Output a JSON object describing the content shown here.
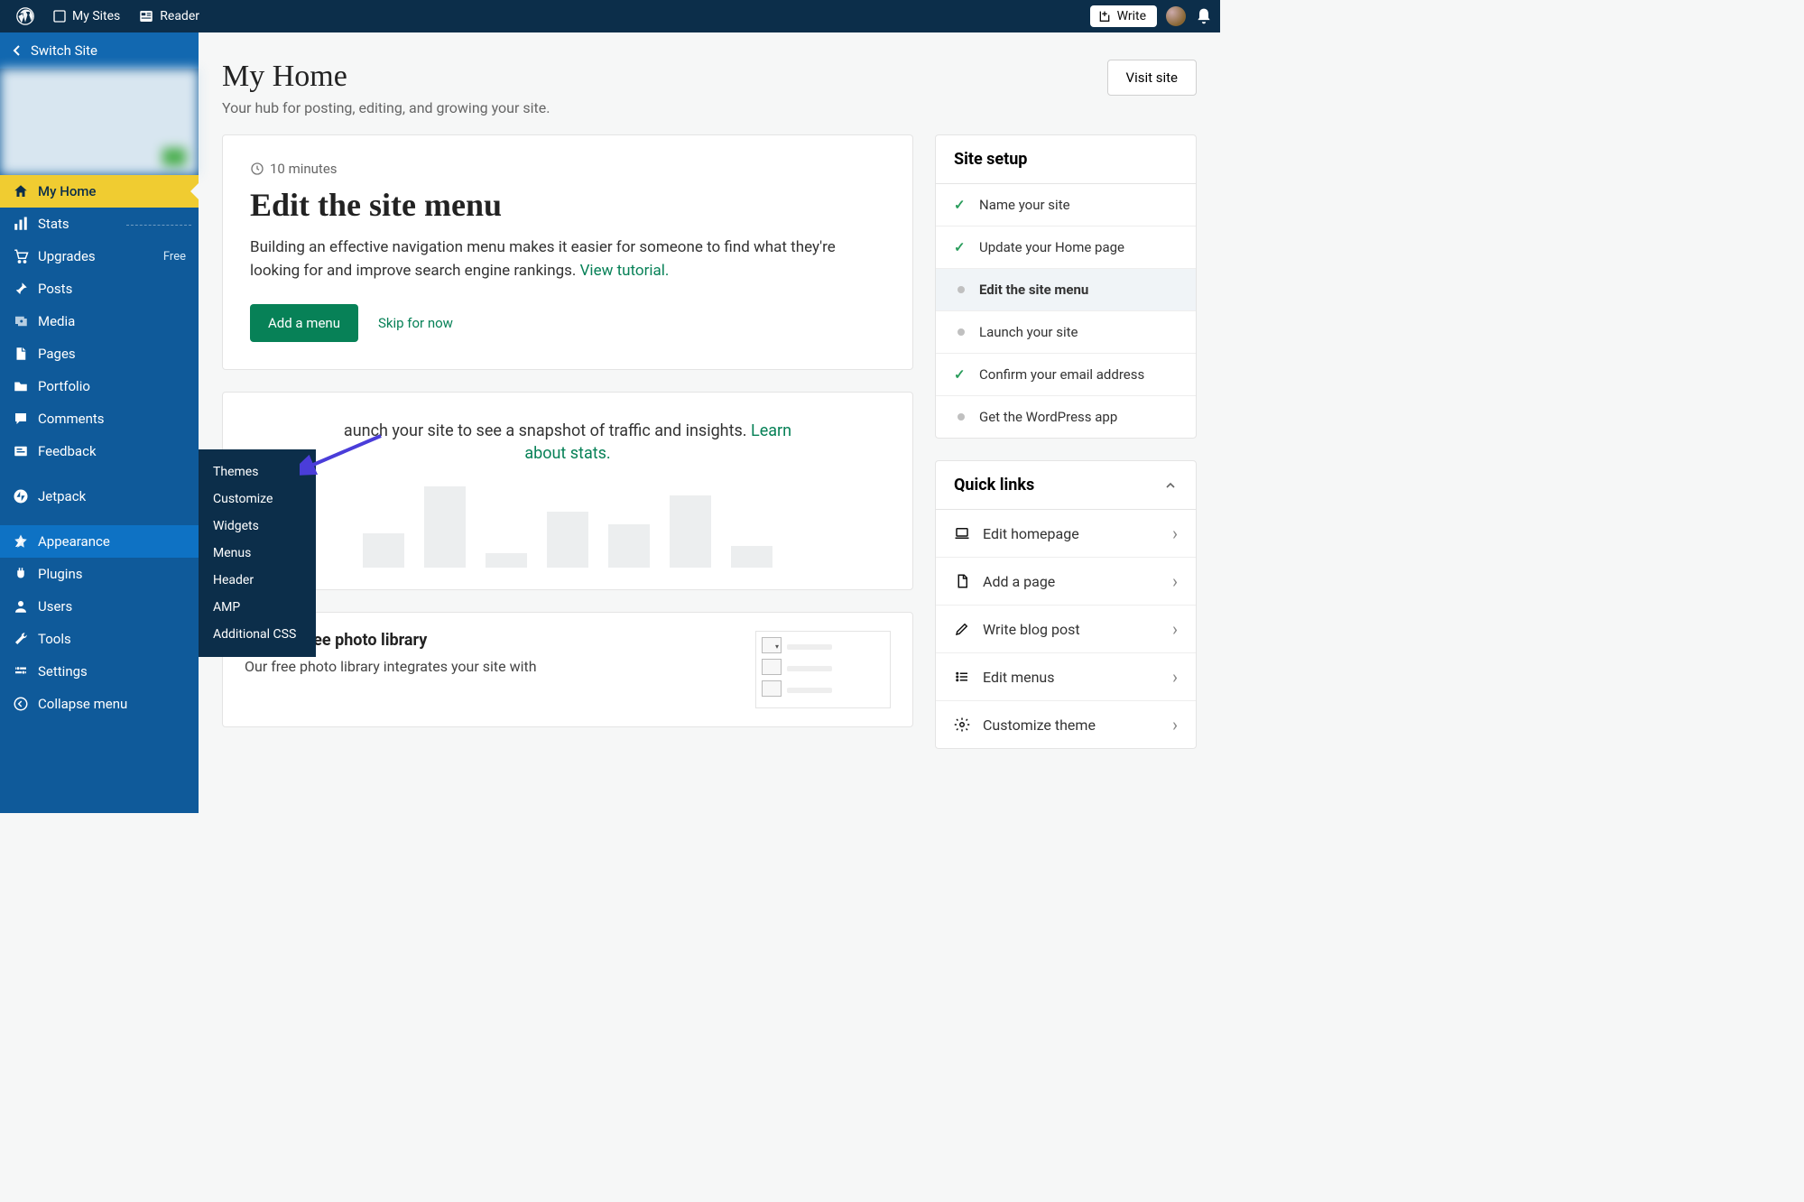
{
  "topbar": {
    "my_sites": "My Sites",
    "reader": "Reader",
    "write": "Write"
  },
  "sidebar": {
    "switch_site": "Switch Site",
    "items": [
      {
        "label": "My Home",
        "icon": "home"
      },
      {
        "label": "Stats",
        "icon": "stats"
      },
      {
        "label": "Upgrades",
        "icon": "cart",
        "badge": "Free"
      },
      {
        "label": "Posts",
        "icon": "pin"
      },
      {
        "label": "Media",
        "icon": "media"
      },
      {
        "label": "Pages",
        "icon": "page"
      },
      {
        "label": "Portfolio",
        "icon": "folder"
      },
      {
        "label": "Comments",
        "icon": "comment"
      },
      {
        "label": "Feedback",
        "icon": "feedback"
      },
      {
        "label": "Jetpack",
        "icon": "jetpack"
      },
      {
        "label": "Appearance",
        "icon": "appearance"
      },
      {
        "label": "Plugins",
        "icon": "plugin"
      },
      {
        "label": "Users",
        "icon": "user"
      },
      {
        "label": "Tools",
        "icon": "wrench"
      },
      {
        "label": "Settings",
        "icon": "settings"
      },
      {
        "label": "Collapse menu",
        "icon": "collapse"
      }
    ]
  },
  "submenu": {
    "items": [
      "Themes",
      "Customize",
      "Widgets",
      "Menus",
      "Header",
      "AMP",
      "Additional CSS"
    ]
  },
  "header": {
    "title": "My Home",
    "subtitle": "Your hub for posting, editing, and growing your site.",
    "visit_btn": "Visit site"
  },
  "task": {
    "time": "10 minutes",
    "title": "Edit the site menu",
    "desc1": "Building an effective navigation menu makes it easier for someone to find what they're looking for and improve search engine rankings. ",
    "link": "View tutorial.",
    "primary_btn": "Add a menu",
    "skip": "Skip for now"
  },
  "stats": {
    "text1": "aunch your site to see a snapshot of traffic and insights. ",
    "link": "Learn about stats.",
    "bars": [
      38,
      90,
      16,
      62,
      48,
      80,
      24
    ]
  },
  "photo": {
    "title": "ss.com free photo library",
    "desc": "Our free photo library integrates your site with"
  },
  "setup": {
    "title": "Site setup",
    "items": [
      {
        "label": "Name your site",
        "done": true
      },
      {
        "label": "Update your Home page",
        "done": true
      },
      {
        "label": "Edit the site menu",
        "done": false,
        "current": true
      },
      {
        "label": "Launch your site",
        "done": false
      },
      {
        "label": "Confirm your email address",
        "done": true
      },
      {
        "label": "Get the WordPress app",
        "done": false
      }
    ]
  },
  "quick": {
    "title": "Quick links",
    "items": [
      {
        "label": "Edit homepage",
        "icon": "laptop"
      },
      {
        "label": "Add a page",
        "icon": "doc"
      },
      {
        "label": "Write blog post",
        "icon": "pencil"
      },
      {
        "label": "Edit menus",
        "icon": "list"
      },
      {
        "label": "Customize theme",
        "icon": "gear-partial"
      }
    ]
  }
}
